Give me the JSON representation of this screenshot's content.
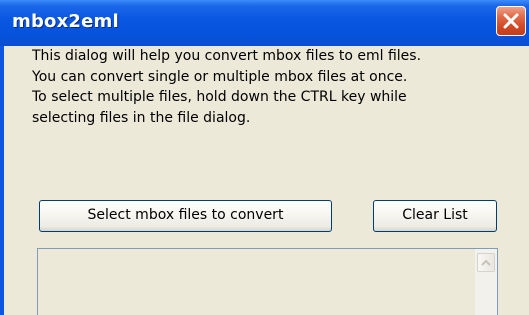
{
  "window": {
    "title": "mbox2eml",
    "close_icon": "close-x-icon"
  },
  "dialog": {
    "description_lines": [
      "This dialog will help you convert mbox files to eml files.",
      "You can convert single or multiple mbox files at once.",
      "To select multiple files, hold down the CTRL key while",
      "selecting files in the file dialog."
    ],
    "select_button_label": "Select mbox files to convert",
    "clear_button_label": "Clear List"
  },
  "listbox": {
    "items": [],
    "scroll_up_icon": "chevron-up-icon"
  },
  "colors": {
    "titlebar": "#0553dc",
    "close_button": "#d14a25",
    "dialog_background": "#ece9d8",
    "button_border": "#003c74"
  }
}
